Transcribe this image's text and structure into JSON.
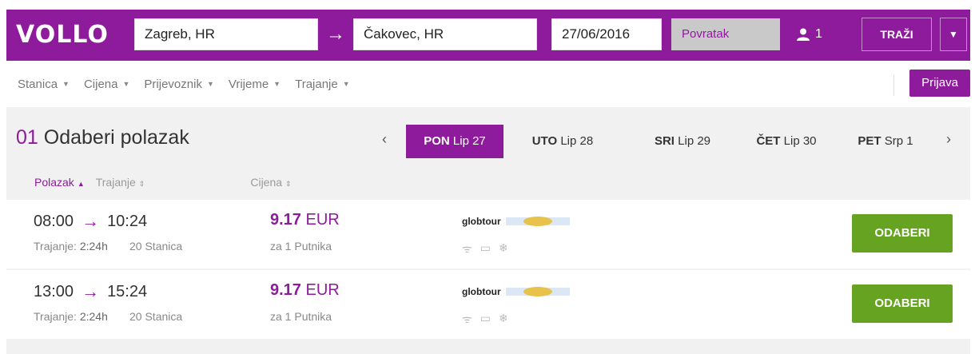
{
  "header": {
    "logo": "VOLLO",
    "from": "Zagreb, HR",
    "to": "Čakovec, HR",
    "date": "27/06/2016",
    "return_placeholder": "Povratak",
    "passengers": "1",
    "search_label": "TRAŽI",
    "brand_color": "#8e1a9c"
  },
  "filters": [
    "Stanica",
    "Cijena",
    "Prijevoznik",
    "Vrijeme",
    "Trajanje"
  ],
  "login_label": "Prijava",
  "step": {
    "number": "01",
    "title": "Odaberi polazak"
  },
  "days": [
    {
      "dow": "PON",
      "date": "Lip 27",
      "active": true
    },
    {
      "dow": "UTO",
      "date": "Lip 28",
      "active": false
    },
    {
      "dow": "SRI",
      "date": "Lip 29",
      "active": false
    },
    {
      "dow": "ČET",
      "date": "Lip 30",
      "active": false
    },
    {
      "dow": "PET",
      "date": "Srp 1",
      "active": false
    }
  ],
  "sort": {
    "departure": "Polazak",
    "duration": "Trajanje",
    "price": "Cijena"
  },
  "trips": [
    {
      "depart": "08:00",
      "arrive": "10:24",
      "duration_label": "Trajanje:",
      "duration": "2:24h",
      "stations": "20 Stanica",
      "price": "9.17",
      "currency": "EUR",
      "per": "za 1 Putnika",
      "carrier": "globtour",
      "amenities": [
        "wifi-icon",
        "screen-icon",
        "ac-icon"
      ],
      "select_label": "ODABERI"
    },
    {
      "depart": "13:00",
      "arrive": "15:24",
      "duration_label": "Trajanje:",
      "duration": "2:24h",
      "stations": "20 Stanica",
      "price": "9.17",
      "currency": "EUR",
      "per": "za 1 Putnika",
      "carrier": "globtour",
      "amenities": [
        "wifi-icon",
        "screen-icon",
        "ac-icon"
      ],
      "select_label": "ODABERI"
    }
  ],
  "accent_green": "#66a321"
}
